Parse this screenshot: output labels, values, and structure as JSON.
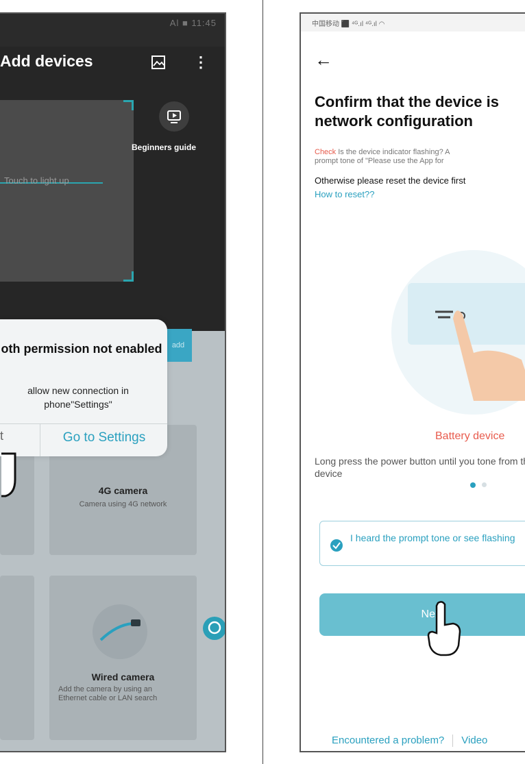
{
  "left_screen": {
    "title": "Add devices",
    "status_right": "Al ■ 11:45",
    "beginners_guide": "Beginners guide",
    "touch_to_light": "Touch to light up",
    "side_button": "add",
    "dialog": {
      "title": "oth permission not enabled",
      "message": "allow new connection in phone\"Settings\"",
      "cancel_label": "t",
      "confirm_label": "Go to Settings"
    },
    "cards": [
      {
        "title": "4G camera",
        "desc": "Camera using 4G network"
      },
      {
        "title": "Wired camera",
        "desc": "Add the camera by using an Ethernet cable or LAN search"
      }
    ],
    "colors": {
      "accent": "#2aa0bf",
      "dark_bg": "#262626"
    },
    "icons": [
      "image-icon",
      "more-vertical-icon",
      "video-guide-icon",
      "ethernet-cable-icon",
      "chat-bubble-icon",
      "hand-pointer-icon"
    ]
  },
  "right_screen": {
    "status_text": "中国移动 ⬛ ⁴ᴳ.ıl ⁴ᴳ.ıl ◠",
    "heading_line1": "Confirm that the device is",
    "heading_line2": "network configuration",
    "check_prefix": "Check",
    "check_rest": " Is the device indicator flashing? A",
    "check_line2": "prompt tone of \"Please use the App for",
    "otherwise": "Otherwise please reset the device first",
    "how_to_reset": "How to reset??",
    "battery_device": "Battery device",
    "long_press": "Long press the power button until you tone from the device",
    "confirm_text": "I heard the prompt tone or see flashing",
    "next_label": "Next",
    "link_problem": "Encountered a problem?",
    "link_video": "Video",
    "colors": {
      "accent": "#2aa0bf",
      "next_bg": "#69bfd0",
      "warning": "#e65a4b"
    },
    "icons": [
      "back-arrow-icon",
      "check-circle-icon",
      "hand-pointer-icon",
      "finger-tap-icon"
    ]
  }
}
